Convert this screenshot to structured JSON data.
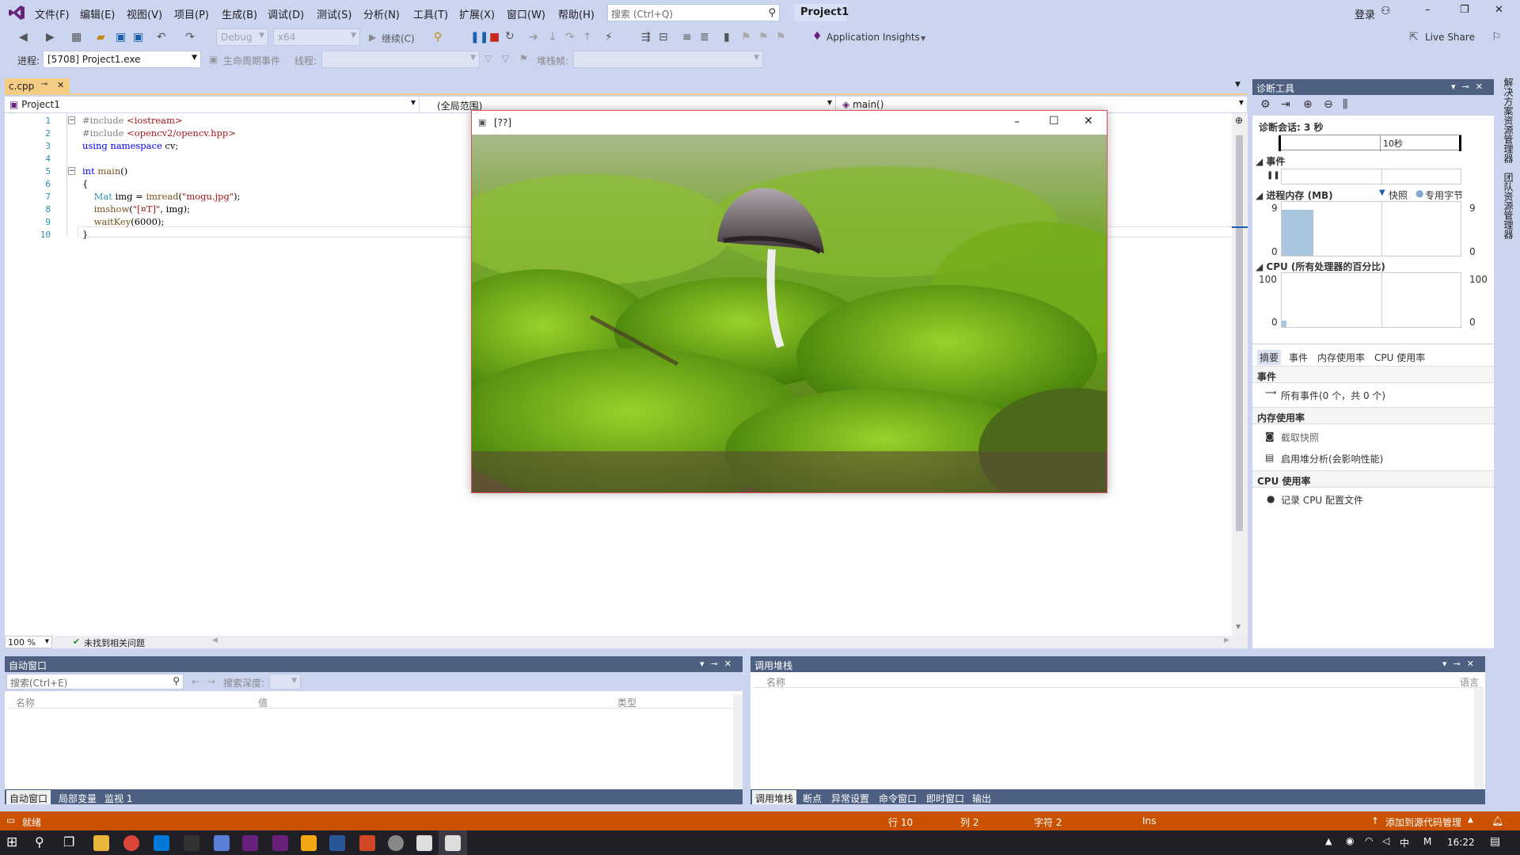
{
  "menu": {
    "items": [
      "文件(F)",
      "编辑(E)",
      "视图(V)",
      "项目(P)",
      "生成(B)",
      "调试(D)",
      "测试(S)",
      "分析(N)",
      "工具(T)",
      "扩展(X)",
      "窗口(W)",
      "帮助(H)"
    ],
    "search_placeholder": "搜索 (Ctrl+Q)",
    "project_title": "Project1",
    "login": "登录"
  },
  "toolbar": {
    "config": "Debug",
    "platform": "x64",
    "continue": "继续(C)",
    "app_insights": "Application Insights",
    "live_share": "Live Share",
    "process_label": "进程:",
    "process_value": "[5708] Project1.exe",
    "lifecycle": "生命周期事件",
    "thread_label": "线程:",
    "stackframe_label": "堆栈帧:"
  },
  "editor": {
    "tab": "c.cpp",
    "nav_project": "Project1",
    "nav_scope": "(全局范围)",
    "nav_func": "main()",
    "zoom": "100 %",
    "issues": "未找到相关问题",
    "lines": [
      {
        "n": "1",
        "text": "#include <iostream>"
      },
      {
        "n": "2",
        "text": "#include <opencv2/opencv.hpp>"
      },
      {
        "n": "3",
        "text": "using namespace cv;"
      },
      {
        "n": "4",
        "text": ""
      },
      {
        "n": "5",
        "text": "int main()"
      },
      {
        "n": "6",
        "text": "{"
      },
      {
        "n": "7",
        "text": "    Mat img = imread(\"mogu.jpg\");"
      },
      {
        "n": "8",
        "text": "    imshow(\"[¤T]\", img);"
      },
      {
        "n": "9",
        "text": "    waitKey(6000);"
      },
      {
        "n": "10",
        "text": "}"
      }
    ]
  },
  "image_window": {
    "title": "[??]"
  },
  "diagnostics": {
    "title": "诊断工具",
    "session": "诊断会话: 3 秒",
    "timeline_label": "10秒",
    "events": "事件",
    "memory": "进程内存 (MB)",
    "snapshot": "快照",
    "private_bytes": "专用字节",
    "mem_max": "9",
    "mem_min": "0",
    "cpu": "CPU (所有处理器的百分比)",
    "cpu_max": "100",
    "cpu_min": "0",
    "tabs": [
      "摘要",
      "事件",
      "内存使用率",
      "CPU 使用率"
    ],
    "section_events": "事件",
    "all_events": "所有事件(0 个，共 0 个)",
    "section_memory": "内存使用率",
    "take_snapshot": "截取快照",
    "heap_profile": "启用堆分析(会影响性能)",
    "section_cpu": "CPU 使用率",
    "record_cpu": "记录 CPU 配置文件"
  },
  "side_tabs": [
    "解决方案资源管理器",
    "团队资源管理器"
  ],
  "autos": {
    "title": "自动窗口",
    "search_placeholder": "搜索(Ctrl+E)",
    "search_depth": "搜索深度:",
    "col_name": "名称",
    "col_value": "值",
    "col_type": "类型",
    "tabs": [
      "自动窗口",
      "局部变量",
      "监视 1"
    ]
  },
  "callstack": {
    "title": "调用堆栈",
    "col_name": "名称",
    "col_lang": "语言",
    "tabs": [
      "调用堆栈",
      "断点",
      "异常设置",
      "命令窗口",
      "即时窗口",
      "输出"
    ]
  },
  "statusbar": {
    "ready": "就绪",
    "line": "行 10",
    "col": "列 2",
    "char": "字符 2",
    "ins": "Ins",
    "source_control": "添加到源代码管理"
  },
  "taskbar": {
    "ime": "中",
    "ime2": "M",
    "time": "16:22"
  },
  "colors": {
    "accent": "#ca5100",
    "tool_window_header": "#4d6082",
    "tab_active": "#f5cc84"
  }
}
